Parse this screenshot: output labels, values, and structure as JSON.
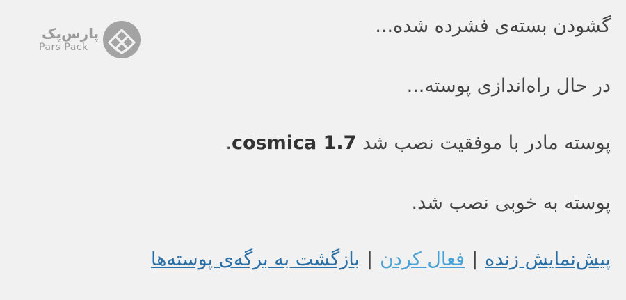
{
  "logo": {
    "name_fa": "پارس‌پک",
    "name_en": "Pars Pack",
    "icon": "diamond-lattice-logo-icon",
    "color": "#9c9c9c"
  },
  "messages": {
    "unpacking": "گشودن بسته‌ی فشرده شده...",
    "installing": "در حال راه‌اندازی پوسته...",
    "parent_installed_prefix": "پوسته مادر با موفقیت نصب شد ",
    "parent_theme_name": "cosmica 1.7",
    "parent_installed_suffix": ".",
    "success": "پوسته به خوبی نصب شد."
  },
  "actions": {
    "live_preview": "پیش‌نمایش زنده",
    "activate": "فعال کردن",
    "back_to_themes": "بازگشت به برگه‌ی پوسته‌ها",
    "separator": "|"
  },
  "colors": {
    "background": "#f1f1f1",
    "text": "#444444",
    "link": "#2a6fa5",
    "link_active": "#4aa3d6"
  }
}
